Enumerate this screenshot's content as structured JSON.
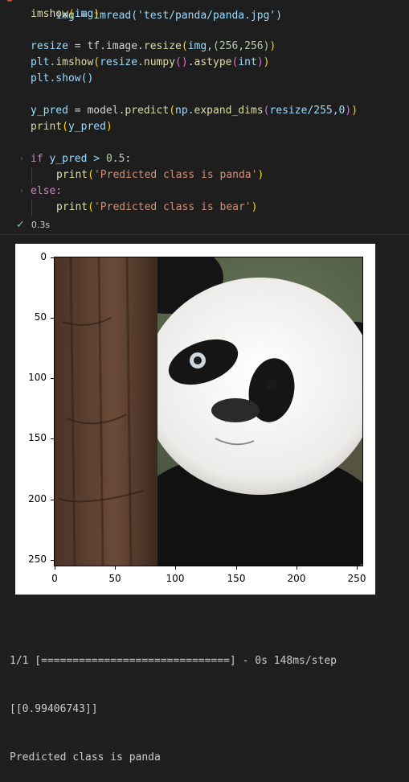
{
  "code": {
    "line0": "img = imread('test/panda/panda.jpg')",
    "line1_fn": "imshow",
    "line1_arg": "img",
    "line3_var": "resize",
    "line3_rest_a": " = tf.image.",
    "line3_fn": "resize",
    "line3_args": "img,",
    "line3_tuple": "(256,256)",
    "line4_a": "plt.",
    "line4_fn": "imshow",
    "line4_b": "resize.",
    "line4_fn2": "numpy",
    "line4_fn3": "astype",
    "line4_c": "int",
    "line5": "plt.show()",
    "line7_var": "y_pred",
    "line7_a": " = model.",
    "line7_fn": "predict",
    "line7_b": "np.",
    "line7_fn2": "expand_dims",
    "line7_c": "resize/255,0",
    "line8_fn": "print",
    "line8_arg": "y_pred",
    "line10_kw": "if",
    "line10_rest": " y_pred > ",
    "line10_num": "0.5",
    "line11_fn": "print",
    "line11_str": "'Predicted class is panda'",
    "line12_kw": "else:",
    "line13_fn": "print",
    "line13_str": "'Predicted class is bear'"
  },
  "cell_status": {
    "time": "0.3s",
    "icon": "check-icon"
  },
  "figure": {
    "y_ticks": [
      "0",
      "50",
      "100",
      "150",
      "200",
      "250"
    ],
    "x_ticks": [
      "0",
      "50",
      "100",
      "150",
      "200",
      "250"
    ],
    "image_subject": "panda-cub-photo"
  },
  "output": {
    "progress": "1/1 [==============================] - 0s 148ms/step",
    "prediction": "[[0.99406743]]",
    "result": "Predicted class is panda"
  },
  "colors": {
    "background": "#1f1f1f",
    "success": "#73c991"
  }
}
